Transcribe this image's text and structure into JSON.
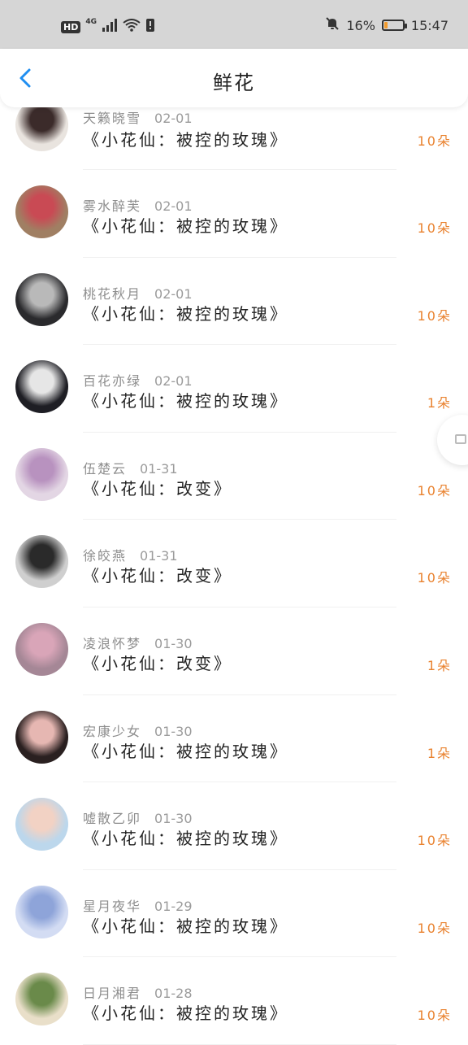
{
  "status_bar": {
    "hd": "HD",
    "network": "4G",
    "battery_text": "16%",
    "battery_level": 0.16,
    "time": "15:47"
  },
  "header": {
    "title": "鲜花"
  },
  "items": [
    {
      "name": "天籁晓雪",
      "date": "02-01",
      "book": "《小花仙：被控的玫瑰》",
      "amount": "10朵",
      "avatar": {
        "bg": "#e9e4df",
        "fg": "#3b2b2a"
      }
    },
    {
      "name": "雾水醉芙",
      "date": "02-01",
      "book": "《小花仙：被控的玫瑰》",
      "amount": "10朵",
      "avatar": {
        "bg": "#a07f63",
        "fg": "#c94a54"
      }
    },
    {
      "name": "桃花秋月",
      "date": "02-01",
      "book": "《小花仙：被控的玫瑰》",
      "amount": "10朵",
      "avatar": {
        "bg": "#2a2a2d",
        "fg": "#b9b9b9"
      }
    },
    {
      "name": "百花亦绿",
      "date": "02-01",
      "book": "《小花仙：被控的玫瑰》",
      "amount": "1朵",
      "avatar": {
        "bg": "#1e1e24",
        "fg": "#e6e6e6"
      }
    },
    {
      "name": "伍楚云",
      "date": "01-31",
      "book": "《小花仙：改变》",
      "amount": "10朵",
      "avatar": {
        "bg": "#e3d6e4",
        "fg": "#b892bf"
      }
    },
    {
      "name": "徐皎燕",
      "date": "01-31",
      "book": "《小花仙：改变》",
      "amount": "10朵",
      "avatar": {
        "bg": "#cfcfcf",
        "fg": "#2a2a2a"
      }
    },
    {
      "name": "凌浪怀梦",
      "date": "01-30",
      "book": "《小花仙：改变》",
      "amount": "1朵",
      "avatar": {
        "bg": "#a58796",
        "fg": "#d9a5b8"
      }
    },
    {
      "name": "宏康少女",
      "date": "01-30",
      "book": "《小花仙：被控的玫瑰》",
      "amount": "1朵",
      "avatar": {
        "bg": "#2a2020",
        "fg": "#e6b7b2"
      }
    },
    {
      "name": "嘘散乙卯",
      "date": "01-30",
      "book": "《小花仙：被控的玫瑰》",
      "amount": "10朵",
      "avatar": {
        "bg": "#bcd7ec",
        "fg": "#f2d2c4"
      }
    },
    {
      "name": "星月夜华",
      "date": "01-29",
      "book": "《小花仙：被控的玫瑰》",
      "amount": "10朵",
      "avatar": {
        "bg": "#d3dcf3",
        "fg": "#8ea4d9"
      }
    },
    {
      "name": "日月湘君",
      "date": "01-28",
      "book": "《小花仙：被控的玫瑰》",
      "amount": "10朵",
      "avatar": {
        "bg": "#e9dfc9",
        "fg": "#6a8a4a"
      }
    }
  ],
  "colors": {
    "accent_amount": "#e9822f",
    "back_arrow": "#1f8ef1"
  }
}
